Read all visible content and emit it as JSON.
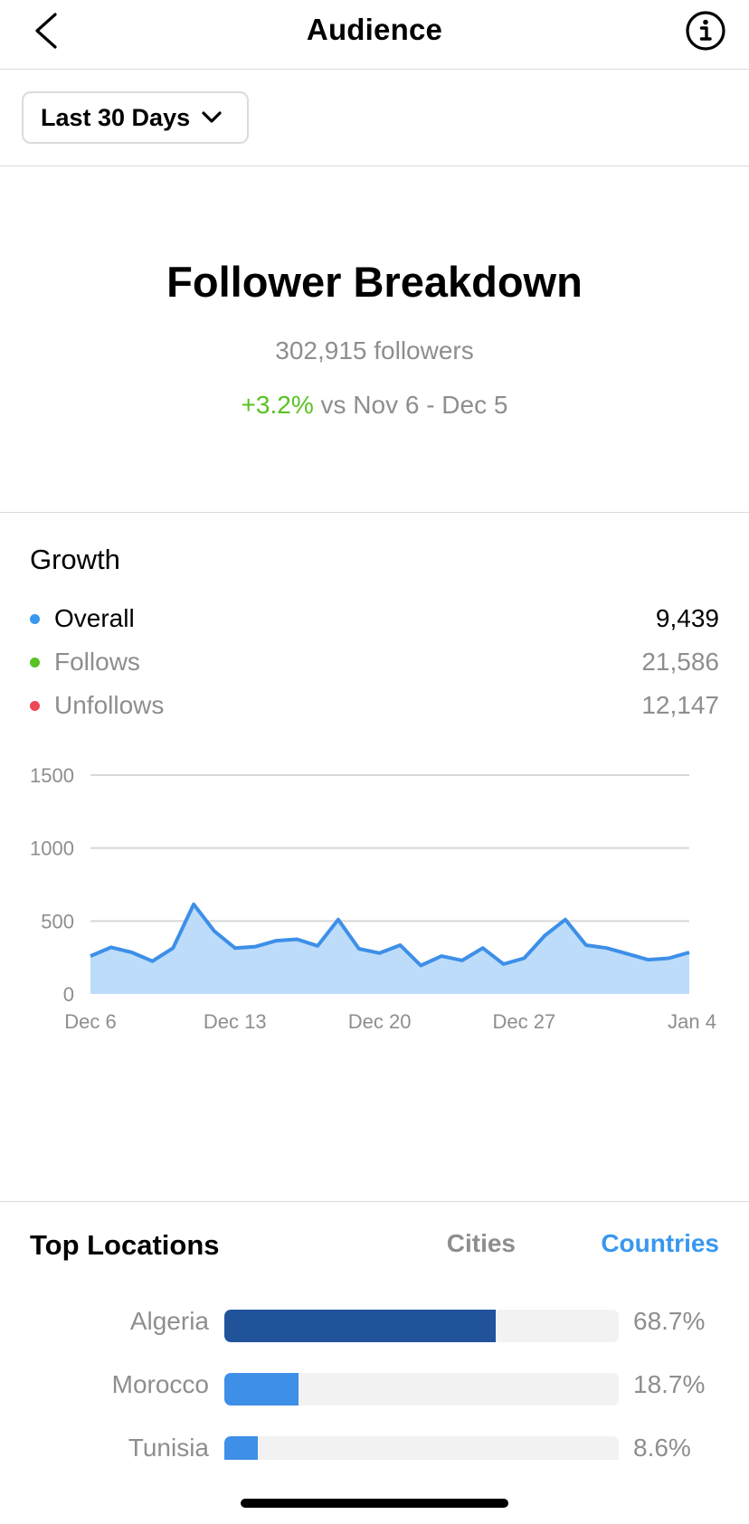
{
  "header": {
    "title": "Audience",
    "back_icon": "chevron-left-icon",
    "info_icon": "info-icon"
  },
  "filter": {
    "label": "Last 30 Days",
    "icon": "chevron-down-icon"
  },
  "summary": {
    "title": "Follower Breakdown",
    "followers": "302,915 followers",
    "change_pct": "+3.2%",
    "change_text": " vs Nov 6 - Dec 5"
  },
  "growth": {
    "title": "Growth",
    "legend": [
      {
        "name": "Overall",
        "value": "9,439",
        "color": "#3897f0"
      },
      {
        "name": "Follows",
        "value": "21,586",
        "color": "#58c322"
      },
      {
        "name": "Unfollows",
        "value": "12,147",
        "color": "#ed4956"
      }
    ]
  },
  "chart_data": {
    "type": "area",
    "yticks": [
      "1500",
      "1000",
      "500",
      "0"
    ],
    "ylim": [
      0,
      1500
    ],
    "xtick_labels": [
      "Dec 6",
      "Dec 13",
      "Dec 20",
      "Dec 27",
      "Jan 4"
    ],
    "xtick_index": [
      0,
      7,
      14,
      21,
      29
    ],
    "grid": true,
    "colors": {
      "line": "#3d8fe8",
      "fill": "#bcdcfa"
    },
    "series": [
      {
        "values": [
          260,
          320,
          285,
          225,
          315,
          615,
          430,
          315,
          325,
          365,
          375,
          330,
          510,
          310,
          280,
          335,
          195,
          260,
          230,
          315,
          205,
          245,
          400,
          510,
          335,
          315,
          275,
          235,
          245,
          285
        ]
      }
    ]
  },
  "locations": {
    "title": "Top Locations",
    "tabs": {
      "cities": "Cities",
      "countries": "Countries"
    },
    "rows": [
      {
        "name": "Algeria",
        "pct": "68.7%",
        "value": 68.7,
        "color": "#21539b"
      },
      {
        "name": "Morocco",
        "pct": "18.7%",
        "value": 18.7,
        "color": "#3d8fe8"
      },
      {
        "name": "Tunisia",
        "pct": "8.6%",
        "value": 8.6,
        "color": "#3d8fe8"
      }
    ]
  }
}
